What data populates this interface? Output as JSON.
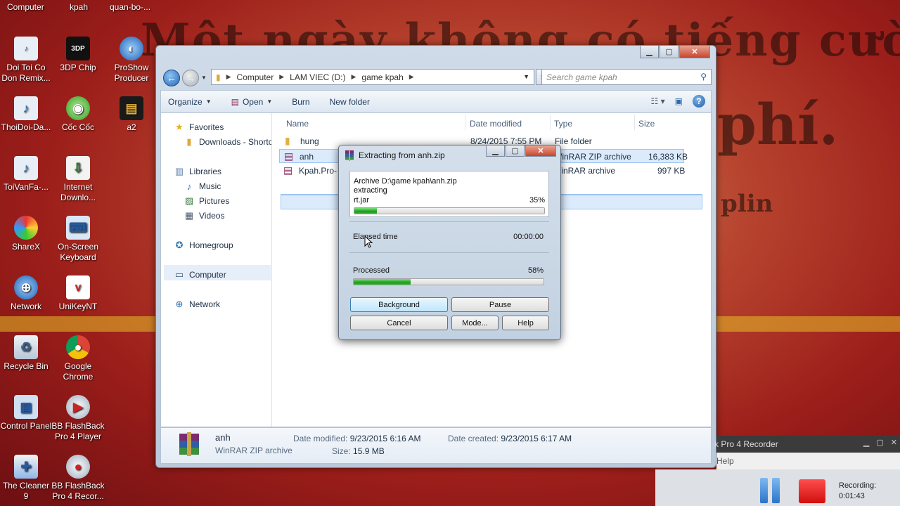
{
  "wallpaper": {
    "line1": "Một ngày không có tiếng cười",
    "line2": "phí.",
    "line3": "plin"
  },
  "desktop": {
    "top_labels": [
      "Computer",
      "kpah",
      "quan-bo-..."
    ],
    "icons": [
      {
        "label": "Doi Toi Co Don Remix...",
        "icon": "mp3-icon"
      },
      {
        "label": "3DP Chip",
        "icon": "3dp-chip-icon"
      },
      {
        "label": "ProShow Producer",
        "icon": "proshow-icon"
      },
      {
        "label": "ThoiDoi-Da...",
        "icon": "mp3-icon"
      },
      {
        "label": "Cốc Cốc",
        "icon": "coccoc-icon"
      },
      {
        "label": "a2",
        "icon": "folder-icon"
      },
      {
        "label": "ToiVanFa-...",
        "icon": "mp3-icon"
      },
      {
        "label": "Internet Downlo...",
        "icon": "idm-icon"
      },
      {
        "label": "ShareX",
        "icon": "sharex-icon"
      },
      {
        "label": "On-Screen Keyboard",
        "icon": "keyboard-icon"
      },
      {
        "label": "Network",
        "icon": "network-icon"
      },
      {
        "label": "UniKeyNT",
        "icon": "unikey-icon"
      },
      {
        "label": "Recycle Bin",
        "icon": "recycle-bin-icon"
      },
      {
        "label": "Google Chrome",
        "icon": "chrome-icon"
      },
      {
        "label": "Control Panel",
        "icon": "control-panel-icon"
      },
      {
        "label": "BB FlashBack Pro 4 Player",
        "icon": "flashback-icon"
      },
      {
        "label": "The Cleaner 9",
        "icon": "cleaner-icon"
      },
      {
        "label": "BB FlashBack Pro 4 Recor...",
        "icon": "flashback-icon"
      }
    ]
  },
  "explorer": {
    "breadcrumb": [
      "Computer",
      "LAM VIEC (D:)",
      "game kpah"
    ],
    "search_placeholder": "Search game kpah",
    "toolbar": {
      "organize": "Organize",
      "open": "Open",
      "burn": "Burn",
      "new_folder": "New folder"
    },
    "nav": {
      "favorites": "Favorites",
      "downloads": "Downloads - Shortcut",
      "libraries": "Libraries",
      "music": "Music",
      "pictures": "Pictures",
      "videos": "Videos",
      "homegroup": "Homegroup",
      "computer": "Computer",
      "network": "Network"
    },
    "columns": {
      "name": "Name",
      "date": "Date modified",
      "type": "Type",
      "size": "Size"
    },
    "files": [
      {
        "name": "hung",
        "date": "8/24/2015 7:55 PM",
        "type": "File folder",
        "size": "",
        "icon": "folder-icon"
      },
      {
        "name": "anh",
        "date": "",
        "type": "WinRAR ZIP archive",
        "size": "16,383 KB",
        "icon": "winrar-icon"
      },
      {
        "name": "Kpah.Pro-",
        "date": "",
        "type": "WinRAR archive",
        "size": "997 KB",
        "icon": "winrar-icon"
      }
    ],
    "details": {
      "name": "anh",
      "type": "WinRAR ZIP archive",
      "modified_label": "Date modified:",
      "modified": "9/23/2015 6:16 AM",
      "size_label": "Size:",
      "size": "15.9 MB",
      "created_label": "Date created:",
      "created": "9/23/2015 6:17 AM"
    }
  },
  "rar": {
    "title": "Extracting from anh.zip",
    "archive": "Archive D:\\game kpah\\anh.zip",
    "action": "extracting",
    "file": "rt.jar",
    "file_pct_label": "35%",
    "file_progress": 0.12,
    "elapsed_label": "Elapsed time",
    "elapsed": "00:00:00",
    "processed_label": "Processed",
    "processed_pct_label": "58%",
    "processed_progress": 0.3,
    "buttons": {
      "background": "Background",
      "pause": "Pause",
      "cancel": "Cancel",
      "mode": "Mode...",
      "help": "Help"
    }
  },
  "recorder": {
    "title": "k Pro 4 Recorder",
    "menu": "Help",
    "status_label": "Recording:",
    "time": "0:01:43"
  }
}
